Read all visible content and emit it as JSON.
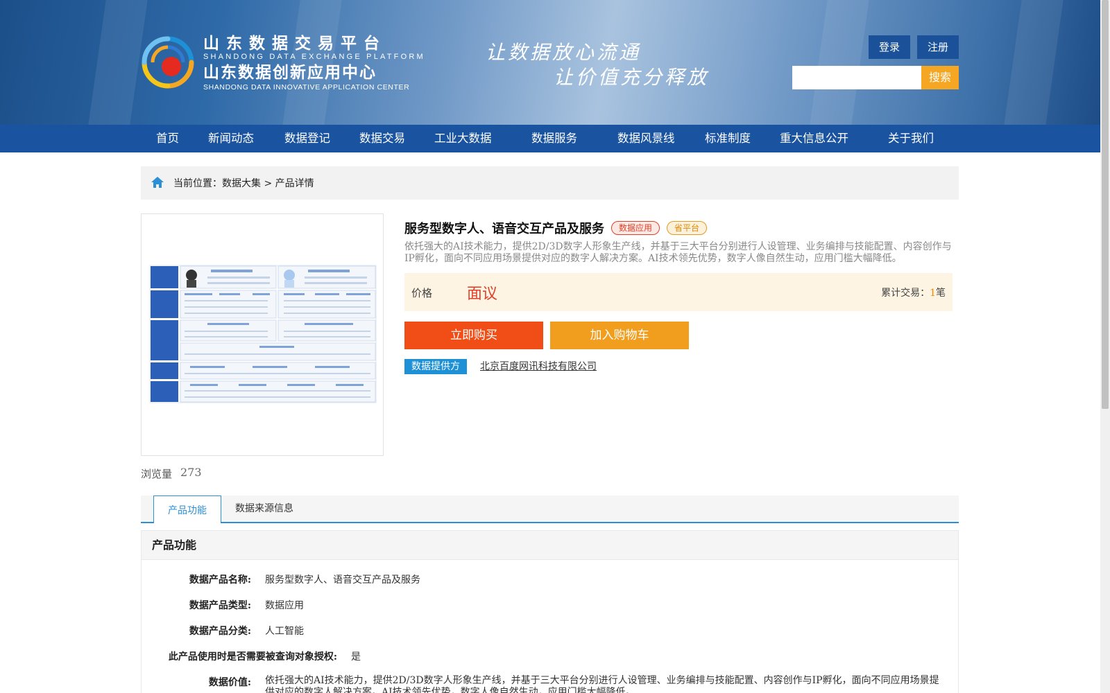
{
  "header": {
    "logo_cn": "山东数据交易平台",
    "logo_en": "SHANDONG DATA EXCHANGE PLATFORM",
    "logo_cn2": "山东数据创新应用中心",
    "logo_en2": "SHANDONG DATA INNOVATIVE APPLICATION CENTER",
    "slogan_line1": "让数据放心流通",
    "slogan_line2": "让价值充分释放",
    "login_label": "登录",
    "register_label": "注册",
    "search_placeholder": "",
    "search_label": "搜索"
  },
  "nav": {
    "items": [
      "首页",
      "新闻动态",
      "数据登记",
      "数据交易",
      "工业大数据",
      "数据服务",
      "数据风景线",
      "标准制度",
      "重大信息公开",
      "关于我们"
    ]
  },
  "breadcrumb": {
    "prefix": "当前位置：",
    "path": "数据大集 > 产品详情"
  },
  "product": {
    "title": "服务型数字人、语音交互产品及服务",
    "tags": [
      "数据应用",
      "省平台"
    ],
    "description": "依托强大的AI技术能力，提供2D/3D数字人形象生产线，并基于三大平台分别进行人设管理、业务编排与技能配置、内容创作与IP孵化，面向不同应用场景提供对应的数字人解决方案。AI技术领先优势，数字人像自然生动，应用门槛大幅降低。",
    "price_label": "价格",
    "price_value": "面议",
    "trade_prefix": "累计交易：",
    "trade_count": "1",
    "trade_unit": "笔",
    "buy_label": "立即购买",
    "cart_label": "加入购物车",
    "provider_label": "数据提供方",
    "provider_name": "北京百度网讯科技有限公司",
    "views_label": "浏览量",
    "views_count": "273"
  },
  "tabs": {
    "items": [
      "产品功能",
      "数据来源信息"
    ],
    "active": "产品功能"
  },
  "section": {
    "title": "产品功能",
    "fields": [
      {
        "label": "数据产品名称:",
        "value": "服务型数字人、语音交互产品及服务"
      },
      {
        "label": "数据产品类型:",
        "value": "数据应用"
      },
      {
        "label": "数据产品分类:",
        "value": "人工智能"
      },
      {
        "label": "此产品使用时是否需要被查询对象授权:",
        "value": "是"
      },
      {
        "label": "数据价值:",
        "value": "依托强大的AI技术能力，提供2D/3D数字人形象生产线，并基于三大平台分别进行人设管理、业务编排与技能配置、内容创作与IP孵化，面向不同应用场景提供对应的数字人解决方案。AI技术领先优势，数字人像自然生动，应用门槛大幅降低。"
      }
    ]
  },
  "colors": {
    "nav_blue": "#1a53a0",
    "accent_orange": "#f5a623",
    "buy_red": "#f04e16",
    "price_red": "#e0402b",
    "tab_blue": "#2a8fd6"
  }
}
